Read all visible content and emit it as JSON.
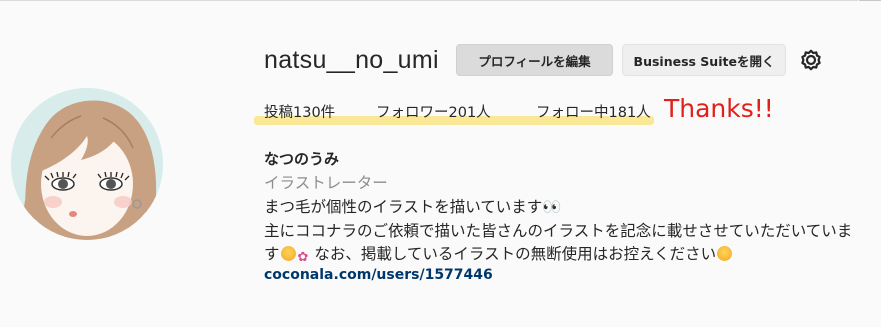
{
  "profile": {
    "username": "natsu__no_umi",
    "edit_button": "プロフィールを編集",
    "suite_button": "Business Suiteを開く",
    "settings_icon": "gear-icon",
    "stats": {
      "posts": "投稿130件",
      "followers": "フォロワー201人",
      "following": "フォロー中181人"
    },
    "thanks_annotation": "Thanks!!",
    "full_name": "なつのうみ",
    "category": "イラストレーター",
    "bio_lines": {
      "line1": "まつ毛が個性のイラストを描いています👀",
      "line2": "主にココナラのご依頼で描いた皆さんのイラストを記念に載せさせていただいていま",
      "line3_a": "す",
      "line3_b": "なお、掲載しているイラストの無断使用はお控えください"
    },
    "link": "coconala.com/users/1577446"
  },
  "colors": {
    "highlight": "#fbe58b",
    "thanks": "#e0211b",
    "link": "#00376b",
    "category": "#8e8e8e"
  }
}
